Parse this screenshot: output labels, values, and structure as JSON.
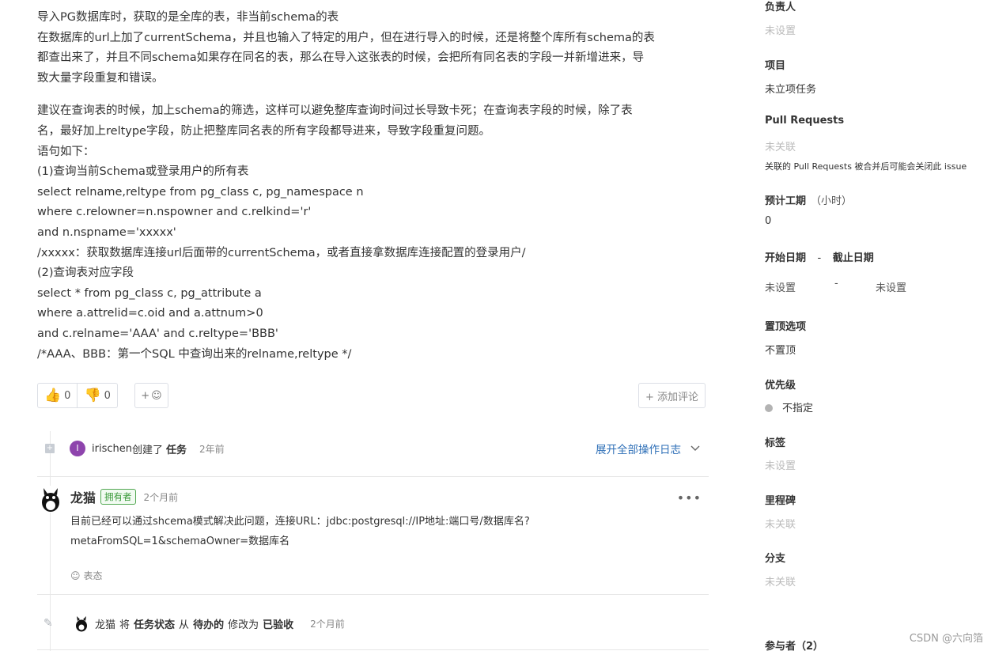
{
  "description": {
    "lines": [
      "导入PG数据库时，获取的是全库的表，非当前schema的表",
      "在数据库的url上加了currentSchema，并且也输入了特定的用户，但在进行导入的时候，还是将整个库所有schema的表",
      "都查出来了，并且不同schema如果存在同名的表，那么在导入这张表的时候，会把所有同名表的字段一并新增进来，导",
      "致大量字段重复和错误。",
      "建议在查询表的时候，加上schema的筛选，这样可以避免整库查询时间过长导致卡死；在查询表字段的时候，除了表",
      "名，最好加上reltype字段，防止把整库同名表的所有字段都导进来，导致字段重复问题。",
      "语句如下：",
      "(1)查询当前Schema或登录用户的所有表",
      "select relname,reltype from pg_class c, pg_namespace n",
      "where c.relowner=n.nspowner and c.relkind='r'",
      "and n.nspname='xxxxx'",
      "/xxxxx：获取数据库连接url后面带的currentSchema，或者直接拿数据库连接配置的登录用户/",
      "(2)查询表对应字段",
      "select * from pg_class c, pg_attribute a",
      "where a.attrelid=c.oid and a.attnum>0",
      "and c.relname='AAA' and c.reltype='BBB'",
      "/*AAA、BBB：第一个SQL 中查询出来的relname,reltype */"
    ]
  },
  "reactions": {
    "thumbs_up_count": "0",
    "thumbs_down_count": "0",
    "add_emoji_label": "+",
    "add_comment_label": "+ 添加评论"
  },
  "timeline": {
    "created": {
      "avatar_letter": "I",
      "user": "irischen",
      "action": "创建了",
      "object": "任务",
      "time": "2年前"
    },
    "expand_label": "展开全部操作日志",
    "comment": {
      "author": "龙猫",
      "badge": "拥有者",
      "time": "2个月前",
      "more": "•••",
      "body_line1": "目前已经可以通过shcema模式解决此问题，连接URL：jdbc:postgresql://IP地址:端口号/数据库名?",
      "body_line2": "metaFromSQL=1&schemaOwner=数据库名",
      "react_label": "表态"
    },
    "status_change": {
      "author": "龙猫",
      "w1": "将",
      "field": "任务状态",
      "w2": "从",
      "from": "待办的",
      "w3": "修改为",
      "to": "已验收",
      "time": "2个月前"
    }
  },
  "sidebar": {
    "assignee": {
      "label": "负责人",
      "value": "未设置"
    },
    "project": {
      "label": "项目",
      "value": "未立项任务"
    },
    "pull_requests": {
      "label": "Pull Requests",
      "value": "未关联",
      "note": "关联的 Pull Requests 被合并后可能会关闭此 issue"
    },
    "estimate": {
      "label": "预计工期",
      "unit": "（小时）",
      "value": "0"
    },
    "dates": {
      "start_label": "开始日期",
      "sep": "-",
      "end_label": "截止日期",
      "start_value": "未设置",
      "end_value": "未设置"
    },
    "pin": {
      "label": "置顶选项",
      "value": "不置顶"
    },
    "priority": {
      "label": "优先级",
      "value": "不指定"
    },
    "tags": {
      "label": "标签",
      "value": "未设置"
    },
    "milestone": {
      "label": "里程碑",
      "value": "未关联"
    },
    "branch": {
      "label": "分支",
      "value": "未关联"
    },
    "participants": {
      "label": "参与者（2）"
    }
  },
  "watermark": "CSDN @六向箔",
  "colors": {
    "link": "#2e6fb7",
    "owner_badge": "#3a9a3a",
    "avatar_i": "#8e44ad",
    "muted": "#bbbbbb"
  }
}
